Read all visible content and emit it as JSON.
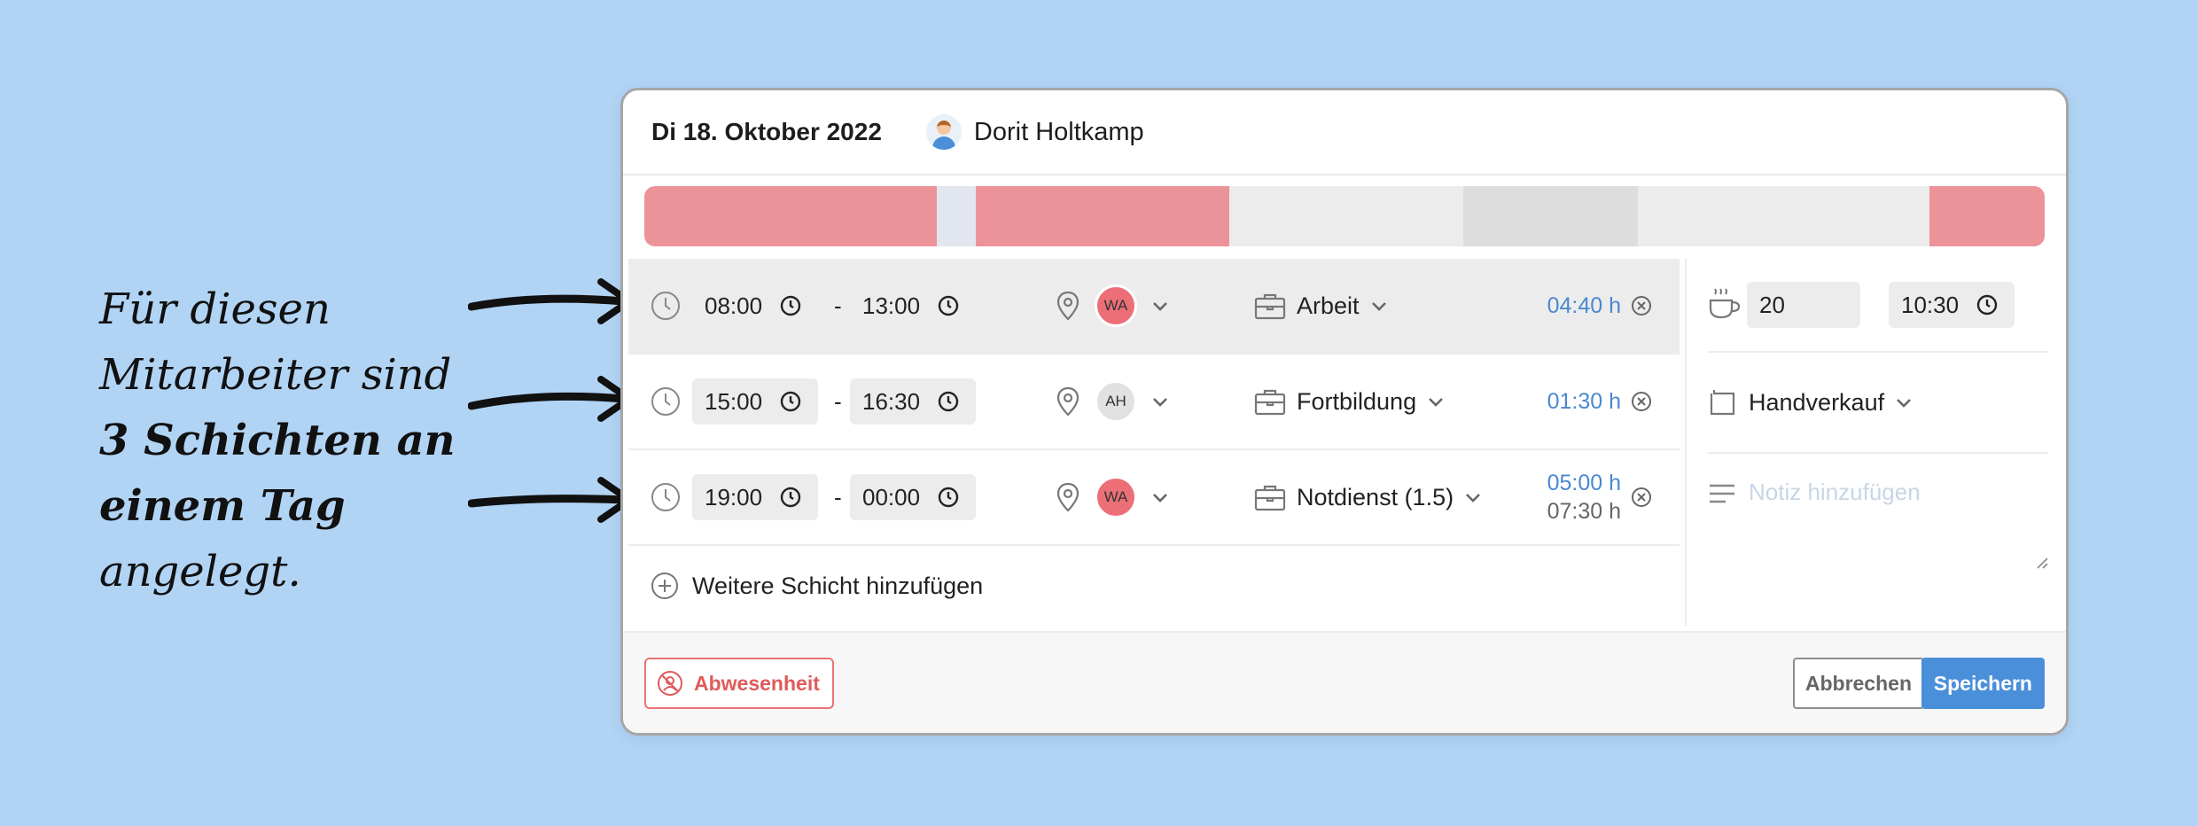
{
  "annotation": {
    "lines": [
      "Für diesen",
      "Mitarbeiter sind",
      "3 Schichten an",
      "einem Tag"
    ],
    "last_suffix": "angelegt."
  },
  "header": {
    "date": "Di 18. Oktober 2022",
    "user_name": "Dorit Holtkamp"
  },
  "colors": {
    "pink": "#ec939a",
    "light_gray": "#ececec",
    "mid_gray": "#dddddd",
    "blue_divider": "#e2e6ee",
    "accent": "#4a8fda",
    "danger": "#e05a5a"
  },
  "shifts": [
    {
      "start": "08:00",
      "end": "13:00",
      "location": "WA",
      "location_color": "#ec6f78",
      "type": "Arbeit",
      "duration": "04:40 h",
      "sub_duration": ""
    },
    {
      "start": "15:00",
      "end": "16:30",
      "location": "AH",
      "location_color": "#e1e1e1",
      "type": "Fortbildung",
      "duration": "01:30 h",
      "sub_duration": ""
    },
    {
      "start": "19:00",
      "end": "00:00",
      "location": "WA",
      "location_color": "#ec6f78",
      "type": "Notdienst (1.5)",
      "duration": "05:00 h",
      "sub_duration": "07:30 h"
    }
  ],
  "dash": "-",
  "add_shift_label": "Weitere Schicht hinzufügen",
  "side": {
    "break_minutes": "20",
    "break_time": "10:30",
    "department": "Handverkauf",
    "note_placeholder": "Notiz hinzufügen"
  },
  "footer": {
    "absence_label": "Abwesenheit",
    "cancel_label": "Abbrechen",
    "save_label": "Speichern"
  },
  "icons": [
    "clock-icon",
    "location-pin-icon",
    "chevron-down-icon",
    "briefcase-icon",
    "close-circle-icon",
    "plus-circle-icon",
    "coffee-cup-icon",
    "square-icon",
    "lines-icon",
    "person-slash-icon",
    "resize-grip-icon"
  ]
}
